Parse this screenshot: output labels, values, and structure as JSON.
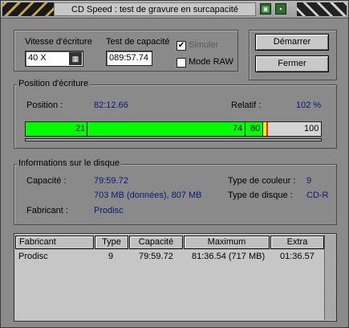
{
  "window": {
    "title": "CD Speed : test de gravure en surcapacité"
  },
  "settings": {
    "speed_label": "Vitesse d'écriture",
    "speed_value": "40 X",
    "capacity_test_label": "Test de capacité",
    "capacity_test_value": "089:57.74",
    "simulate_label": "Simuler",
    "simulate_checked": true,
    "raw_mode_label": "Mode RAW",
    "raw_mode_checked": false
  },
  "buttons": {
    "start": "Démarrer",
    "close": "Fermer"
  },
  "write_position": {
    "group_title": "Position d'écriture",
    "position_label": "Position :",
    "position_value": "82:12.66",
    "relative_label": "Relatif :",
    "relative_value": "102 %",
    "progress_fraction": 1.02,
    "segments": [
      {
        "label": "21",
        "color": "#00ff00"
      },
      {
        "label": "74",
        "color": "#00ff00"
      },
      {
        "label": "80",
        "color": "#00ff00"
      },
      {
        "label": "",
        "color": "#ffee00"
      },
      {
        "label": "",
        "color": "#ff2222"
      },
      {
        "label": "100",
        "color": "#d4d4d4"
      }
    ]
  },
  "disc_info": {
    "group_title": "Informations sur le disque",
    "capacity_label": "Capacité :",
    "capacity_value": "79:59.72",
    "capacity_detail": "703 MB (données), 807 MB",
    "manufacturer_label": "Fabricant :",
    "manufacturer_value": "Prodisc",
    "dye_type_label": "Type de couleur :",
    "dye_type_value": "9",
    "disc_type_label": "Type de disque :",
    "disc_type_value": "CD-R"
  },
  "table": {
    "headers": [
      "Fabricant",
      "Type",
      "Capacité",
      "Maximum",
      "Extra"
    ],
    "rows": [
      [
        "Prodisc",
        "9",
        "79:59.72",
        "81:36.54 (717 MB)",
        "01:36.57"
      ]
    ]
  }
}
